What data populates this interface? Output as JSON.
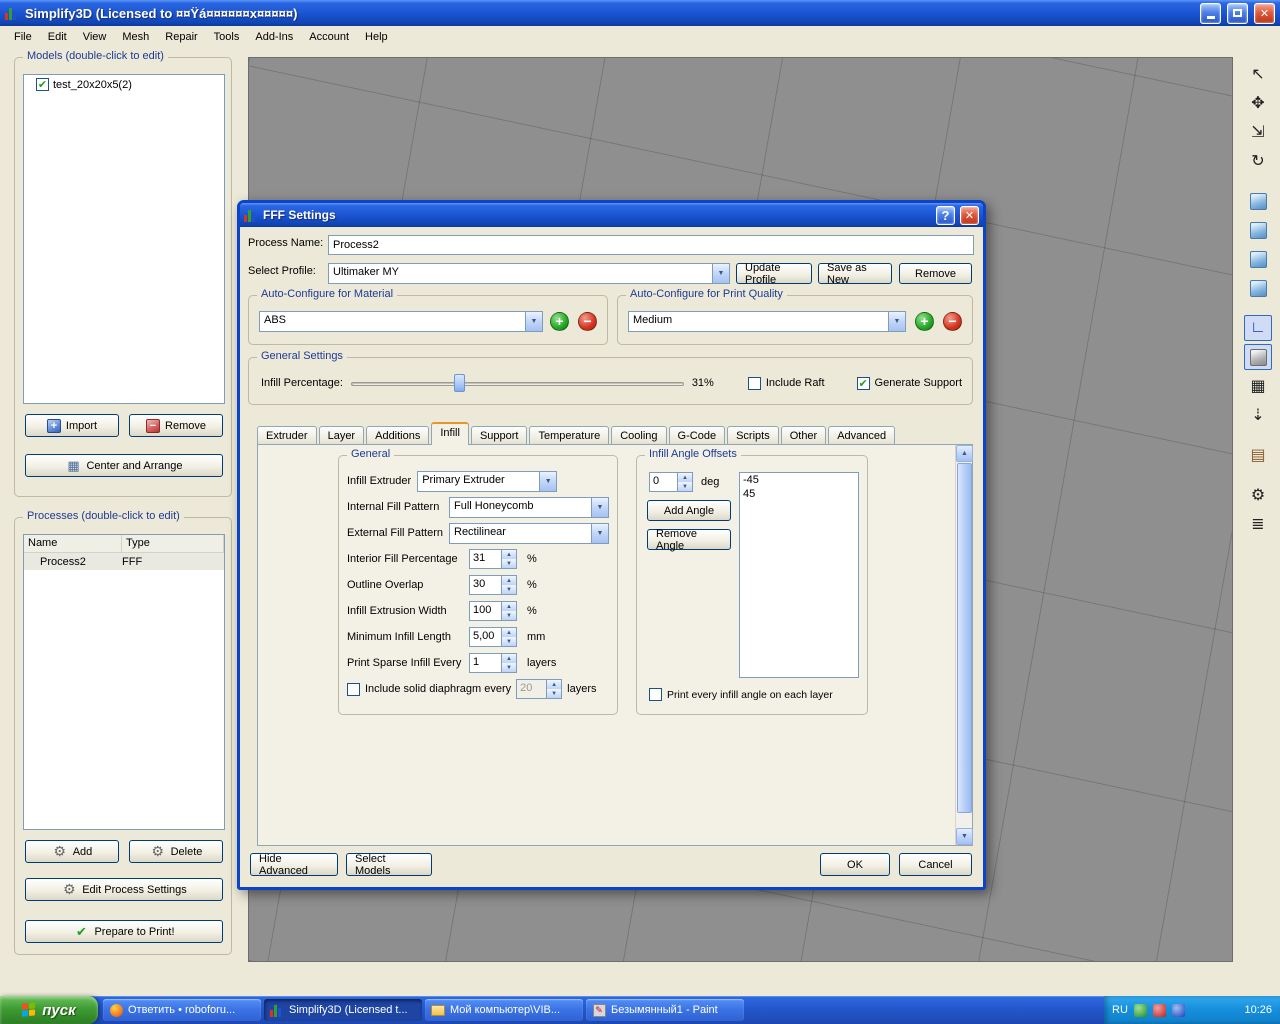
{
  "window": {
    "title": "Simplify3D (Licensed to ¤¤Ÿá¤¤¤¤¤¤x¤¤¤¤¤)"
  },
  "menubar": {
    "items": [
      "File",
      "Edit",
      "View",
      "Mesh",
      "Repair",
      "Tools",
      "Add-Ins",
      "Account",
      "Help"
    ]
  },
  "left_panel": {
    "models_header": "Models (double-click to edit)",
    "model_item": "test_20x20x5(2)",
    "processes_header": "Processes (double-click to edit)",
    "process_columns": [
      "Name",
      "Type"
    ],
    "process_row": {
      "name": "Process2",
      "type": "FFF"
    },
    "buttons": {
      "import": "Import",
      "remove": "Remove",
      "center_and_arrange": "Center and Arrange",
      "add": "Add",
      "delete": "Delete",
      "edit_process_settings": "Edit Process Settings",
      "prepare_to_print": "Prepare to Print!"
    }
  },
  "right_toolbar": {
    "icons": [
      {
        "name": "select-cursor",
        "glyph": "↖"
      },
      {
        "name": "translate-model",
        "glyph": "✥"
      },
      {
        "name": "scale-model",
        "glyph": "⇲"
      },
      {
        "name": "rotate-model",
        "glyph": "↻"
      },
      {
        "name": "view-cube-1",
        "glyph": ""
      },
      {
        "name": "view-cube-2",
        "glyph": ""
      },
      {
        "name": "view-cube-3",
        "glyph": ""
      },
      {
        "name": "view-cube-4",
        "glyph": ""
      },
      {
        "name": "coordinate-axes",
        "glyph": "∟"
      },
      {
        "name": "solid-view",
        "glyph": ""
      },
      {
        "name": "wireframe-view",
        "glyph": "▦"
      },
      {
        "name": "surface-normals",
        "glyph": "⇣"
      },
      {
        "name": "support-structures",
        "glyph": "▤"
      },
      {
        "name": "machine-settings",
        "glyph": "⚙"
      },
      {
        "name": "layer-view",
        "glyph": "≣"
      }
    ]
  },
  "dialog": {
    "title": "FFF Settings",
    "fields": {
      "process_name": {
        "label": "Process Name:",
        "value": "Process2"
      },
      "select_profile": {
        "label": "Select Profile:",
        "value": "Ultimaker MY"
      }
    },
    "buttons": {
      "update_profile": "Update Profile",
      "save_as_new": "Save as New",
      "remove": "Remove",
      "hide_advanced": "Hide Advanced",
      "select_models": "Select Models",
      "ok": "OK",
      "cancel": "Cancel"
    },
    "material": {
      "legend": "Auto-Configure for Material",
      "value": "ABS"
    },
    "quality": {
      "legend": "Auto-Configure for Print Quality",
      "value": "Medium"
    },
    "general": {
      "legend": "General Settings",
      "infill_label": "Infill Percentage:",
      "infill_value": "31%",
      "include_raft": "Include Raft",
      "generate_support": "Generate Support"
    },
    "tabs": [
      "Extruder",
      "Layer",
      "Additions",
      "Infill",
      "Support",
      "Temperature",
      "Cooling",
      "G-Code",
      "Scripts",
      "Other",
      "Advanced"
    ],
    "active_tab": "Infill",
    "infill": {
      "general_legend": "General",
      "combo_rows": [
        {
          "label": "Infill Extruder",
          "value": "Primary Extruder"
        },
        {
          "label": "Internal Fill Pattern",
          "value": "Full Honeycomb"
        },
        {
          "label": "External Fill Pattern",
          "value": "Rectilinear"
        }
      ],
      "spin_rows": [
        {
          "label": "Interior Fill Percentage",
          "value": "31",
          "unit": "%"
        },
        {
          "label": "Outline Overlap",
          "value": "30",
          "unit": "%"
        },
        {
          "label": "Infill Extrusion Width",
          "value": "100",
          "unit": "%"
        },
        {
          "label": "Minimum Infill Length",
          "value": "5,00",
          "unit": "mm"
        },
        {
          "label": "Print Sparse Infill Every",
          "value": "1",
          "unit": "layers"
        }
      ],
      "diaphragm": {
        "label": "Include solid diaphragm every",
        "value": "20",
        "unit": "layers"
      },
      "angle_legend": "Infill Angle Offsets",
      "angle": {
        "value": "0",
        "unit": "deg",
        "add": "Add Angle",
        "remove": "Remove Angle",
        "list": [
          "-45",
          "45"
        ],
        "per_layer": "Print every infill angle on each layer"
      }
    }
  },
  "taskbar": {
    "start": "пуск",
    "tasks": [
      {
        "label": "Ответить • roboforu..."
      },
      {
        "label": "Simplify3D (Licensed t..."
      },
      {
        "label": "Мой компьютер\\VIB..."
      },
      {
        "label": "Безымянный1 - Paint"
      }
    ],
    "tray": {
      "lang": "RU",
      "time": "10:26"
    }
  }
}
